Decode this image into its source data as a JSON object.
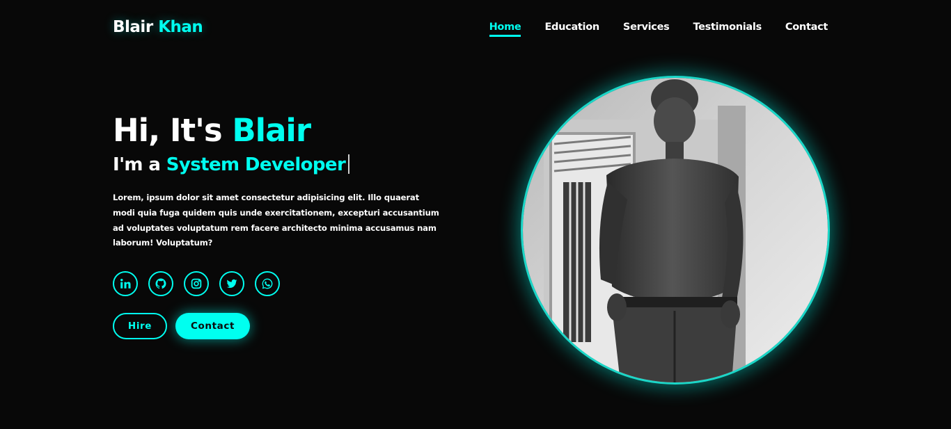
{
  "header": {
    "logo_first": "Blair",
    "logo_second": "Khan",
    "nav": [
      "Home",
      "Education",
      "Services",
      "Testimonials",
      "Contact"
    ],
    "active_nav": "Home"
  },
  "hero": {
    "greeting": "Hi, It's",
    "name": "Blair",
    "role_prefix": "I'm a",
    "role": "System Developer",
    "description": "Lorem, ipsum dolor sit amet consectetur adipisicing elit. Illo quaerat modi quia fuga quidem quis unde exercitationem, excepturi accusantium ad voluptates voluptatum rem facere architecto minima accusamus nam laborum! Voluptatum?",
    "socials": [
      "linkedin-icon",
      "github-icon",
      "instagram-icon",
      "twitter-icon",
      "whatsapp-icon"
    ],
    "hire_label": "Hire",
    "contact_label": "Contact"
  },
  "colors": {
    "accent": "#00fff0",
    "background": "#080808",
    "text": "#ffffff"
  }
}
